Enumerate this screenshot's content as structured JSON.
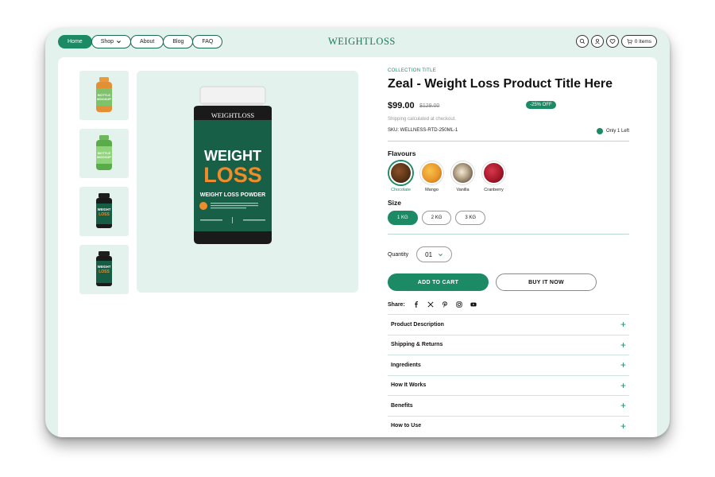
{
  "header": {
    "nav": [
      {
        "label": "Home",
        "active": true
      },
      {
        "label": "Shop",
        "dropdown": true
      },
      {
        "label": "About"
      },
      {
        "label": "Blog"
      },
      {
        "label": "FAQ"
      }
    ],
    "logo": "WEIGHTLOSS",
    "cart_label": "0 Items"
  },
  "product": {
    "collection": "COLLECTION TITLE",
    "title": "Zeal - Weight Loss Product Title Here",
    "price": "$99.00",
    "old_price": "$129.00",
    "discount": "-25% OFF",
    "shipping_note": "Shipping calculated at checkout.",
    "sku": "SKU: WELLNESS-RTD-250ML-1",
    "stock": "Only 1 Left"
  },
  "bottle": {
    "brand": "WEIGHTLOSS",
    "line1": "WEIGHT",
    "line2": "LOSS",
    "subtitle": "WEIGHT LOSS POWDER"
  },
  "thumb_mockup": {
    "line1": "BOTTLE",
    "line2": "MOCKUP"
  },
  "flavours": {
    "label": "Flavours",
    "items": [
      {
        "name": "Chocolate",
        "selected": true,
        "color": "#5a3418"
      },
      {
        "name": "Mango",
        "color": "#e9962b"
      },
      {
        "name": "Vanilla",
        "color": "#6a5a48"
      },
      {
        "name": "Cranberry",
        "color": "#a5182a"
      }
    ]
  },
  "sizes": {
    "label": "Size",
    "items": [
      {
        "name": "1 KG",
        "selected": true
      },
      {
        "name": "2 KG"
      },
      {
        "name": "3 KG"
      }
    ]
  },
  "quantity": {
    "label": "Quantity",
    "value": "01"
  },
  "buttons": {
    "add_to_cart": "ADD TO CART",
    "buy_now": "BUY IT NOW"
  },
  "share": {
    "label": "Share:"
  },
  "accordion": [
    "Product Description",
    "Shipping & Returns",
    "Ingredients",
    "How It Works",
    "Benefits",
    "How to Use"
  ],
  "colors": {
    "accent": "#1c8a64",
    "frame_bg": "#e3f2ec"
  }
}
